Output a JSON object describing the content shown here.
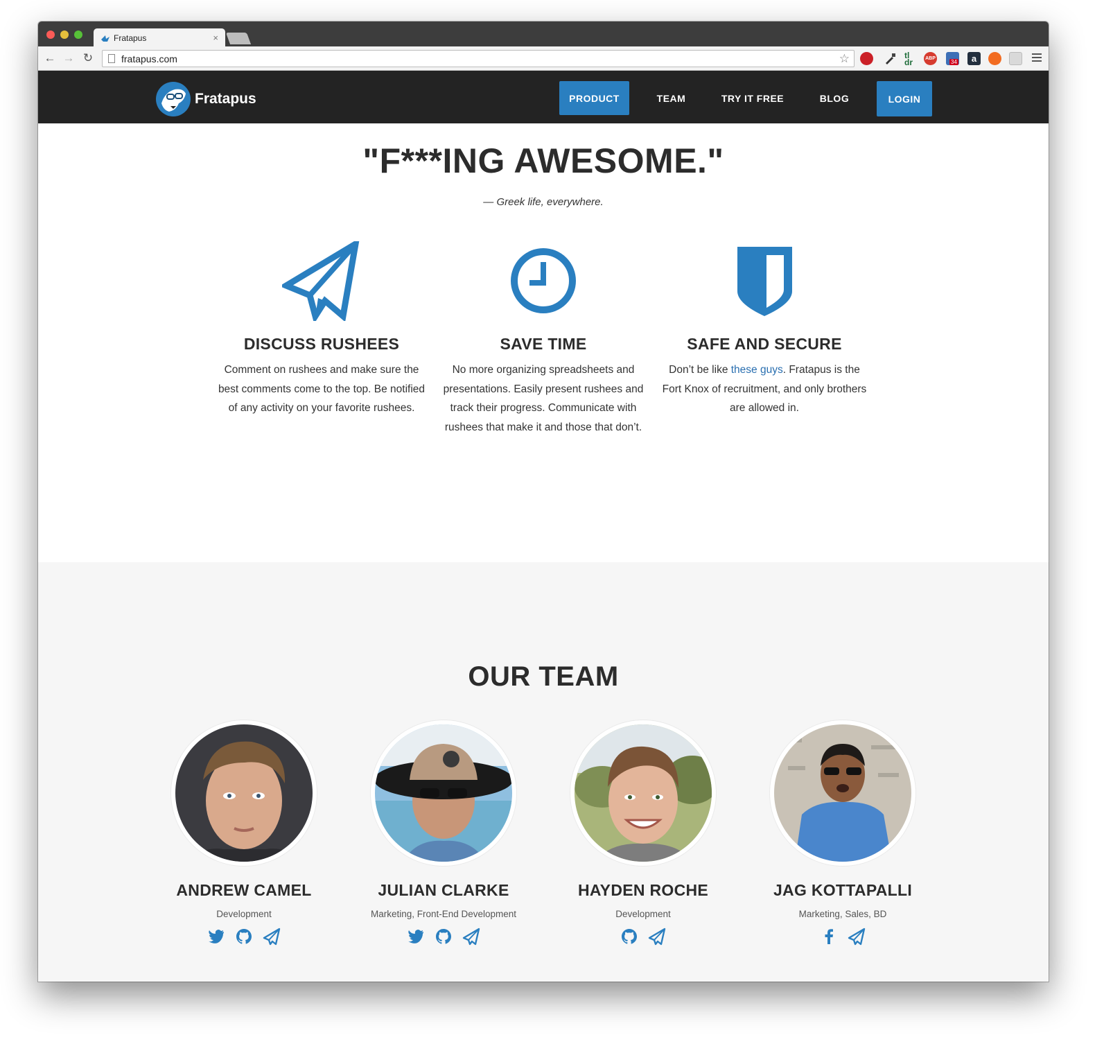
{
  "browser": {
    "tab_title": "Fratapus",
    "tab_close": "×",
    "url": "fratapus.com",
    "back_icon": "←",
    "forward_icon": "→",
    "reload_icon": "↻",
    "star_icon": "☆",
    "extension_icons": [
      "pinterest-icon",
      "eyedropper-icon",
      "tldr-icon",
      "adblock-icon",
      "extension-badge-icon",
      "amazon-icon",
      "honey-icon",
      "inactive-extension-icon"
    ],
    "extension_badge": "34"
  },
  "nav": {
    "brand": "Fratapus",
    "links": [
      {
        "label": "PRODUCT",
        "active": true
      },
      {
        "label": "TEAM",
        "active": false
      },
      {
        "label": "TRY IT FREE",
        "active": false
      },
      {
        "label": "BLOG",
        "active": false
      },
      {
        "label": "LOGIN",
        "active": false
      }
    ],
    "accent": "#2a7fc0"
  },
  "hero": {
    "quote": "\"F***ING AWESOME.\"",
    "cite": "— Greek life, everywhere."
  },
  "features": [
    {
      "icon": "paper-plane-icon",
      "title": "DISCUSS RUSHEES",
      "text": "Comment on rushees and make sure the best comments come to the top. Be notified of any activity on your favorite rushees."
    },
    {
      "icon": "clock-icon",
      "title": "SAVE TIME",
      "text": "No more organizing spreadsheets and presentations. Easily present rushees and track their progress. Communicate with rushees that make it and those that don’t."
    },
    {
      "icon": "shield-icon",
      "title": "SAFE AND SECURE",
      "text_before": "Don’t be like ",
      "link": "these guys",
      "text_after": ". Fratapus is the Fort Knox of recruitment, and only brothers are allowed in."
    }
  ],
  "team": {
    "title": "OUR TEAM",
    "members": [
      {
        "name": "ANDREW CAMEL",
        "role": "Development",
        "links": [
          "twitter-icon",
          "github-icon",
          "paper-plane-icon"
        ]
      },
      {
        "name": "JULIAN CLARKE",
        "role": "Marketing, Front-End Development",
        "links": [
          "twitter-icon",
          "github-icon",
          "paper-plane-icon"
        ]
      },
      {
        "name": "HAYDEN ROCHE",
        "role": "Development",
        "links": [
          "github-icon",
          "paper-plane-icon"
        ]
      },
      {
        "name": "JAG KOTTAPALLI",
        "role": "Marketing, Sales, BD",
        "links": [
          "facebook-icon",
          "paper-plane-icon"
        ]
      }
    ]
  }
}
